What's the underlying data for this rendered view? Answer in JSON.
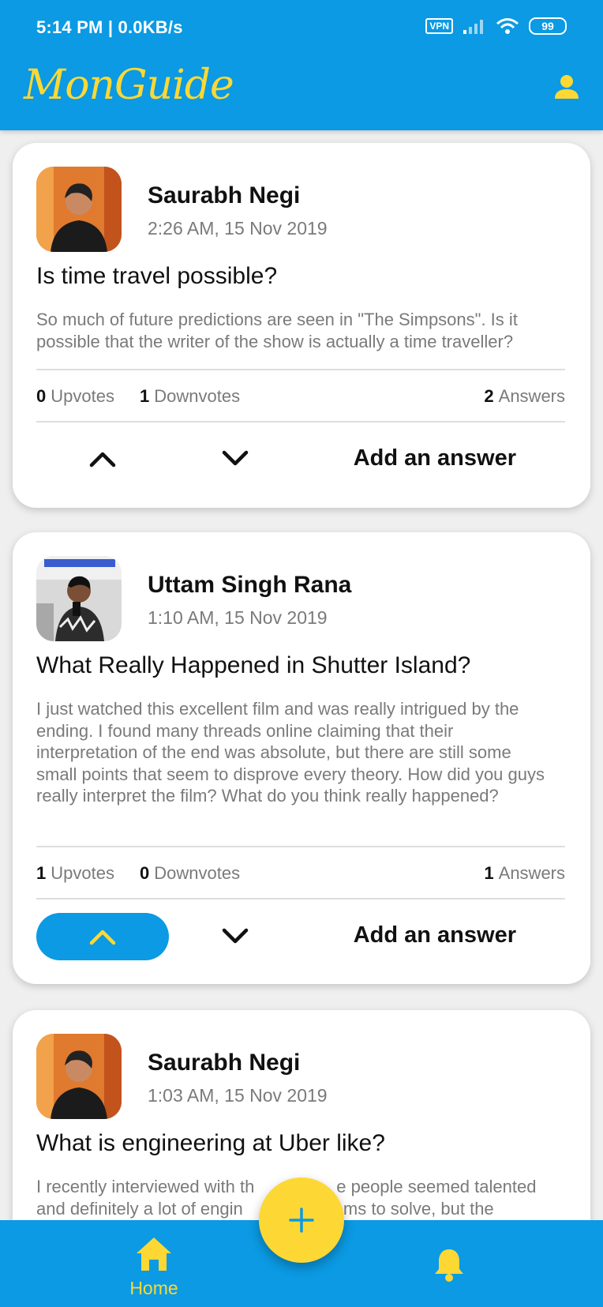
{
  "status_bar": {
    "time": "5:14 PM | 0.0KB/s",
    "vpn": "VPN",
    "battery": "99"
  },
  "app_bar": {
    "title": "MonGuide",
    "profile_icon": "person-icon"
  },
  "colors": {
    "primary": "#0b9ae3",
    "accent": "#fdd835"
  },
  "posts": [
    {
      "author": "Saurabh Negi",
      "time": "2:26 AM, 15 Nov 2019",
      "title": "Is time travel possible?",
      "body": "So much of future predictions are seen in \"The Simpsons\". Is it possible that the writer of the show is actually a time traveller?",
      "upvotes": "0",
      "upvotes_label": "Upvotes",
      "downvotes": "1",
      "downvotes_label": "Downvotes",
      "answers": "2",
      "answers_label": "Answers",
      "upvoted": false,
      "add_answer": "Add an answer"
    },
    {
      "author": "Uttam Singh Rana",
      "time": "1:10 AM, 15 Nov 2019",
      "title": "What Really Happened in Shutter Island?",
      "body": "I just watched this excellent film and was really intrigued by the ending. I found many threads online claiming that their interpretation of the end was absolute, but there are still some small points that seem to disprove every theory. How did you guys really interpret the film? What do you think really happened?",
      "upvotes": "1",
      "upvotes_label": "Upvotes",
      "downvotes": "0",
      "downvotes_label": "Downvotes",
      "answers": "1",
      "answers_label": "Answers",
      "upvoted": true,
      "add_answer": "Add an answer"
    },
    {
      "author": "Saurabh Negi",
      "time": "1:03 AM, 15 Nov 2019",
      "title": "What is engineering at Uber like?",
      "body": "I recently interviewed with th                 e people seemed talented and definitely a lot of engin                blems to solve, but the"
    }
  ],
  "bottom_nav": {
    "home_label": "Home",
    "home_icon": "home-icon",
    "notifications_icon": "bell-icon",
    "fab_icon": "plus-icon"
  }
}
